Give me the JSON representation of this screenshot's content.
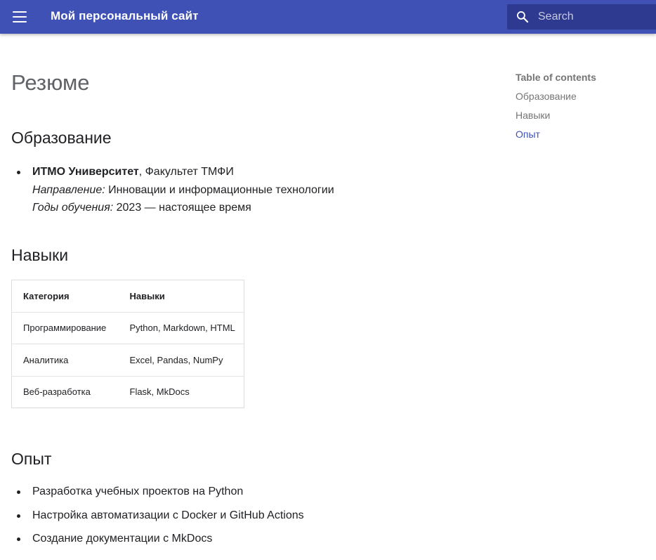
{
  "header": {
    "title": "Мой персональный сайт",
    "search_placeholder": "Search",
    "bg_color": "#3f51b5",
    "search_bg": "#2e3a8f"
  },
  "page": {
    "title": "Резюме"
  },
  "education": {
    "heading": "Образование",
    "university": "ИТМО Университет",
    "faculty": ", Факультет ТМФИ",
    "direction_label": "Направление:",
    "direction_value": " Инновации и информационные технологии",
    "years_label": "Годы обучения:",
    "years_value": " 2023 — настоящее время"
  },
  "skills": {
    "heading": "Навыки",
    "columns": [
      "Категория",
      "Навыки"
    ],
    "rows": [
      [
        "Программирование",
        "Python, Markdown, HTML"
      ],
      [
        "Аналитика",
        "Excel, Pandas, NumPy"
      ],
      [
        "Веб-разработка",
        "Flask, MkDocs"
      ]
    ]
  },
  "experience": {
    "heading": "Опыт",
    "items": [
      "Разработка учебных проектов на Python",
      "Настройка автоматизации с Docker и GitHub Actions",
      "Создание документации с MkDocs"
    ]
  },
  "toc": {
    "title": "Table of contents",
    "items": [
      "Образование",
      "Навыки",
      "Опыт"
    ],
    "active_item": "Опыт",
    "active_color": "#3f51b5"
  }
}
